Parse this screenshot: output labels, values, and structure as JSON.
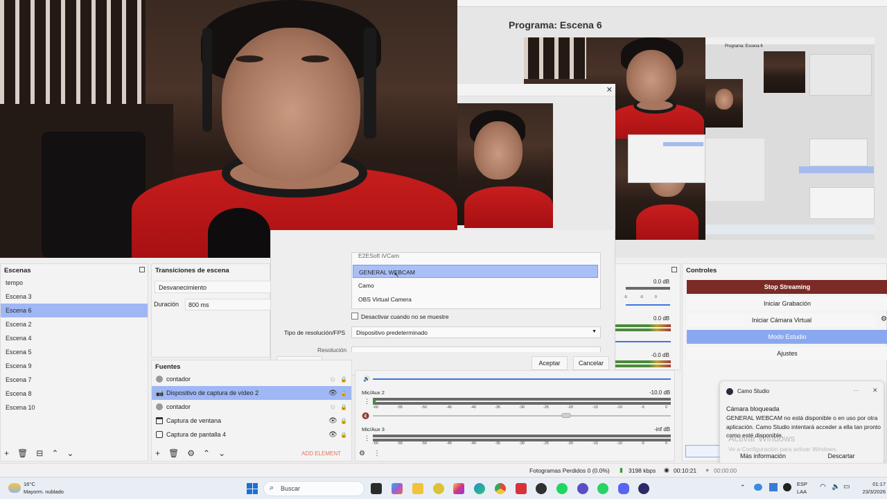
{
  "program": {
    "title": "Programa: Escena 6"
  },
  "scenes": {
    "header": "Escenas",
    "items": [
      "tempo",
      "Escena 3",
      "Escena 6",
      "Escena 2",
      "Escena 4",
      "Escena 5",
      "Escena 9",
      "Escena 7",
      "Escena 8",
      "Escena 10"
    ],
    "selected_index": 2
  },
  "transitions": {
    "header": "Transiciones de escena",
    "type": "Desvanecimiento",
    "duration_label": "Duración",
    "duration_value": "800 ms"
  },
  "sources": {
    "header": "Fuentes",
    "items": [
      {
        "name": "contador",
        "icon": "counter-icon"
      },
      {
        "name": "Dispositivo de captura de vídeo 2",
        "icon": "camera-icon"
      },
      {
        "name": "contador",
        "icon": "counter-icon"
      },
      {
        "name": "Captura de ventana",
        "icon": "window-icon"
      },
      {
        "name": "Captura de pantalla 4",
        "icon": "monitor-icon"
      }
    ],
    "selected_index": 1,
    "add_element": "ADD ELEMENT"
  },
  "properties_dialog": {
    "device_list": [
      "E2ESoft iVCam",
      "GENERAL WEBCAM",
      "Camo",
      "OBS Virtual Camera"
    ],
    "selected_device_index": 1,
    "deactivate_label": "Desactivar cuando no se muestre",
    "resolution_type_label": "Tipo de resolución/FPS",
    "resolution_type_value": "Dispositivo predeterminado",
    "resolution_label": "Resolución",
    "defaults_button": "Por defecto",
    "accept_button": "Aceptar",
    "cancel_button": "Cancelar"
  },
  "mixer": {
    "channels": [
      {
        "name": "",
        "db": "0.0 dB"
      },
      {
        "name": "",
        "db": "0.0 dB"
      },
      {
        "name": "",
        "db": "-0.0 dB"
      },
      {
        "name": "Mic/Aux 2",
        "db": "-10.0 dB"
      },
      {
        "name": "Mic/Aux 3",
        "db": "-inf dB"
      }
    ],
    "scale": [
      "-60",
      "-55",
      "-50",
      "-45",
      "-40",
      "-35",
      "-30",
      "-25",
      "-20",
      "-15",
      "-10",
      "-5",
      "0"
    ]
  },
  "controls": {
    "header": "Controles",
    "stop_streaming": "Stop Streaming",
    "start_recording": "Iniciar Grabación",
    "start_virtual_camera": "Iniciar Cámara Virtual",
    "studio_mode": "Modo Estudio",
    "settings": "Ajustes"
  },
  "notification": {
    "app": "Camo Studio",
    "title": "Cámara bloqueada",
    "body": "GENERAL WEBCAM no está disponible o en uso por otra aplicación. Camo Studio intentará acceder a ella tan pronto como esté disponible.",
    "more_info": "Más información",
    "dismiss": "Descartar",
    "watermark_title": "Activar Windows",
    "watermark_sub": "Ve a Configuración para activar Windows."
  },
  "statusbar": {
    "dropped_frames": "Fotogramas Perdidos 0 (0.0%)",
    "bitrate": "3198 kbps",
    "live_time": "00:10:21",
    "rec_time": "00:00:00"
  },
  "taskbar": {
    "weather_temp": "16°C",
    "weather_desc": "Mayorm. nublado",
    "search_placeholder": "Buscar",
    "lang_1": "ESP",
    "lang_2": "LAA",
    "time": "01:17",
    "date": "23/3/2026"
  },
  "colors": {
    "selection": "#9fb7f5",
    "stop_streaming_bg": "#7b2a26",
    "studio_mode_bg": "#8aa8f0",
    "shirt_red": "#c81e1e"
  }
}
